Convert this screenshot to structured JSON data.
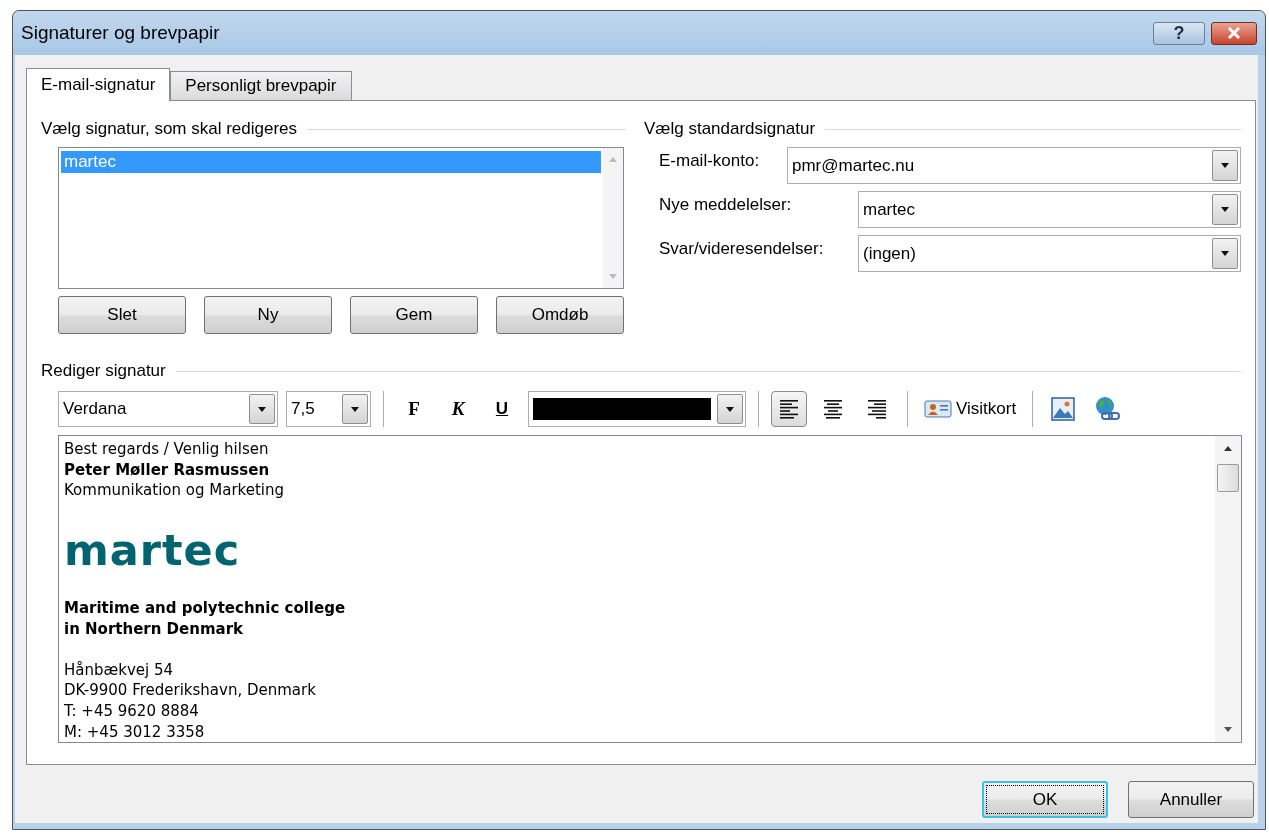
{
  "window": {
    "title": "Signaturer og brevpapir",
    "help": "?"
  },
  "tabs": [
    {
      "label": "E-mail-signatur",
      "selected": true
    },
    {
      "label": "Personligt brevpapir",
      "selected": false
    }
  ],
  "signatures": {
    "heading": "Vælg signatur, som skal redigeres",
    "items": [
      {
        "label": "martec",
        "selected": true
      }
    ],
    "buttons": [
      "Slet",
      "Ny",
      "Gem",
      "Omdøb"
    ]
  },
  "defaults": {
    "heading": "Vælg standardsignatur",
    "fields": [
      {
        "label": "E-mail-konto:",
        "value": "pmr@martec.nu",
        "wide": true
      },
      {
        "label": "Nye meddelelser:",
        "value": "martec",
        "wide": false
      },
      {
        "label": "Svar/videresendelser:",
        "value": "(ingen)",
        "wide": false
      }
    ]
  },
  "editor": {
    "heading": "Rediger signatur",
    "font": "Verdana",
    "size": "7,5",
    "format_buttons": [
      {
        "label": "F",
        "kind": "bold"
      },
      {
        "label": "K",
        "kind": "italic"
      },
      {
        "label": "U",
        "kind": "underline"
      }
    ],
    "color": "#000000",
    "alignment": [
      {
        "kind": "left",
        "selected": true
      },
      {
        "kind": "center",
        "selected": false
      },
      {
        "kind": "right",
        "selected": false
      }
    ],
    "business_card": "Visitkort",
    "blocks": [
      {
        "kind": "text",
        "lines": [
          {
            "text": "Best regards / Venlig hilsen",
            "bold": false
          },
          {
            "text": "Peter Møller Rasmussen",
            "bold": true
          },
          {
            "text": "Kommunikation og Marketing",
            "bold": false
          }
        ]
      },
      {
        "kind": "logo",
        "text": "martec"
      },
      {
        "kind": "text",
        "lines": [
          {
            "text": "Maritime and polytechnic college",
            "bold": true
          },
          {
            "text": "in Northern Denmark",
            "bold": true
          }
        ]
      },
      {
        "kind": "text",
        "lines": [
          {
            "text": "Hånbækvej 54",
            "bold": false
          },
          {
            "text": "DK-9900 Frederikshavn, Denmark",
            "bold": false
          },
          {
            "text": "T: +45 9620 8884",
            "bold": false
          },
          {
            "text": "M: +45 3012 3358",
            "bold": false
          }
        ]
      }
    ]
  },
  "footer_buttons": [
    {
      "label": "OK",
      "default": true
    },
    {
      "label": "Annuller",
      "default": false
    }
  ]
}
